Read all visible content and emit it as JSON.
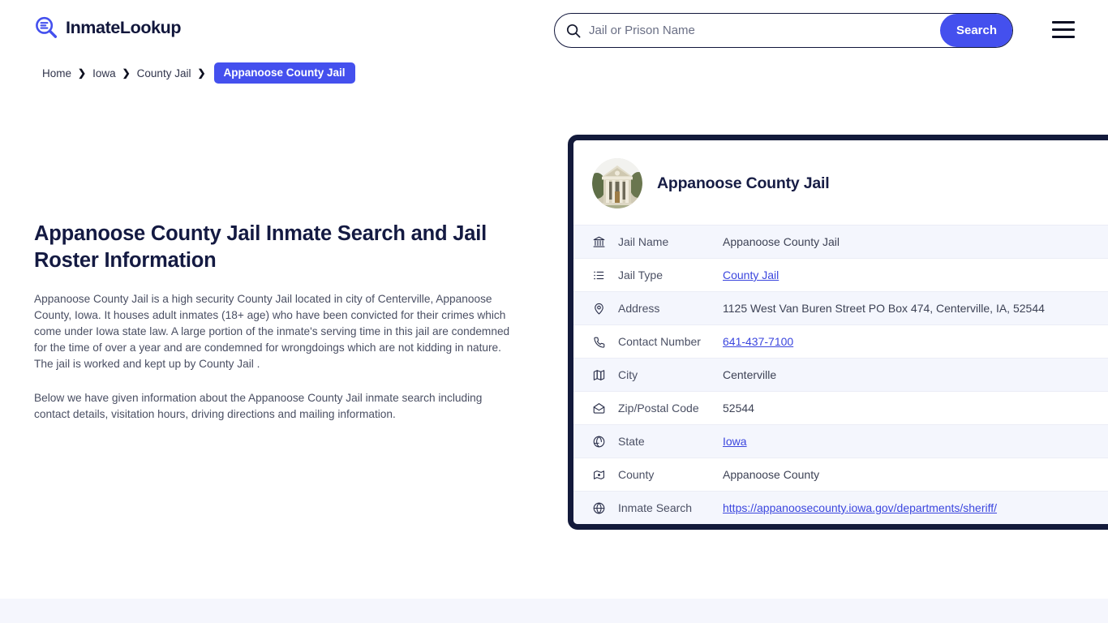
{
  "header": {
    "brand_name": "InmateLookup",
    "brand_icon": "magnifier-list-icon",
    "search": {
      "placeholder": "Jail or Prison Name",
      "value": "",
      "icon": "search-icon",
      "button_label": "Search"
    },
    "menu_icon": "hamburger-menu-icon"
  },
  "breadcrumb": {
    "items": [
      {
        "label": "Home",
        "current": false
      },
      {
        "label": "Iowa",
        "current": false
      },
      {
        "label": "County Jail",
        "current": false
      },
      {
        "label": "Appanoose County Jail",
        "current": true
      }
    ],
    "separator": "❯"
  },
  "main": {
    "title": "Appanoose County Jail Inmate Search and Jail Roster Information",
    "paragraph_1": "Appanoose County Jail is a high security County Jail located in city of Centerville, Appanoose County, Iowa. It houses adult inmates (18+ age) who have been convicted for their crimes which come under Iowa state law. A large portion of the inmate's serving time in this jail are condemned for the time of over a year and are condemned for wrongdoings which are not kidding in nature. The jail is worked and kept up by County Jail .",
    "paragraph_2": "Below we have given information about the Appanoose County Jail inmate search including contact details, visitation hours, driving directions and mailing information."
  },
  "card": {
    "title": "Appanoose County Jail",
    "avatar_alt": "courthouse-photo",
    "rows": [
      {
        "icon": "bank-landmark-icon",
        "label": "Jail Name",
        "value": "Appanoose County Jail",
        "link": false
      },
      {
        "icon": "list-icon",
        "label": "Jail Type",
        "value": "County Jail",
        "link": true
      },
      {
        "icon": "map-pin-icon",
        "label": "Address",
        "value": "1125 West Van Buren Street PO Box 474, Centerville, IA, 52544",
        "link": false
      },
      {
        "icon": "phone-icon",
        "label": "Contact Number",
        "value": "641-437-7100",
        "link": true
      },
      {
        "icon": "map-folded-icon",
        "label": "City",
        "value": "Centerville",
        "link": false
      },
      {
        "icon": "envelope-open-icon",
        "label": "Zip/Postal Code",
        "value": "52544",
        "link": false
      },
      {
        "icon": "globe-compass-icon",
        "label": "State",
        "value": "Iowa",
        "link": true
      },
      {
        "icon": "map-dot-icon",
        "label": "County",
        "value": "Appanoose County",
        "link": false
      },
      {
        "icon": "globe-grid-icon",
        "label": "Inmate Search",
        "value": "https://appanoosecounty.iowa.gov/departments/sheriff/",
        "link": true
      }
    ]
  },
  "colors": {
    "accent": "#4450ee",
    "card_border": "#131a3b",
    "link": "#3b46de",
    "row_alt_bg": "#f4f6fd",
    "bottom_band": "#f5f6fd",
    "heading": "#141a42"
  }
}
